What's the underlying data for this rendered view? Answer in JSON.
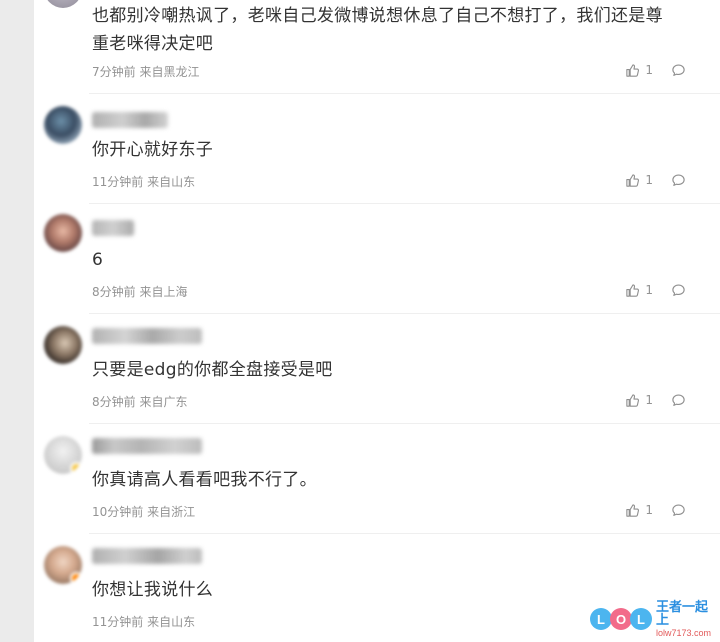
{
  "comments": [
    {
      "username_blurred": true,
      "content_line1": "也都别冷嘲热讽了，老咪自己发微博说想休息了自己不想打了，我们还是尊",
      "content_line2": "重老咪得决定吧",
      "time": "7分钟前",
      "location": "来自黑龙江",
      "likes": "1"
    },
    {
      "username_blurred": true,
      "content": "你开心就好东子",
      "time": "11分钟前",
      "location": "来自山东",
      "likes": "1"
    },
    {
      "username_blurred": true,
      "content": "6",
      "time": "8分钟前",
      "location": "来自上海",
      "likes": "1"
    },
    {
      "username_blurred": true,
      "content": "只要是edg的你都全盘接受是吧",
      "time": "8分钟前",
      "location": "来自广东",
      "likes": "1"
    },
    {
      "username_blurred": true,
      "content": "你真请高人看看吧我不行了。",
      "time": "10分钟前",
      "location": "来自浙江",
      "likes": "1"
    },
    {
      "username_blurred": true,
      "content": "你想让我说什么",
      "time": "11分钟前",
      "location": "来自山东",
      "likes": ""
    }
  ],
  "icons": {
    "like": "thumbs-up-icon",
    "reply": "comment-bubble-icon"
  },
  "colors": {
    "text": "#333333",
    "meta": "#939393",
    "background": "#ebebeb",
    "panel": "#ffffff"
  },
  "watermark": {
    "logo": "LOL",
    "main": "王者一起上",
    "url": "lolw7173.com"
  }
}
